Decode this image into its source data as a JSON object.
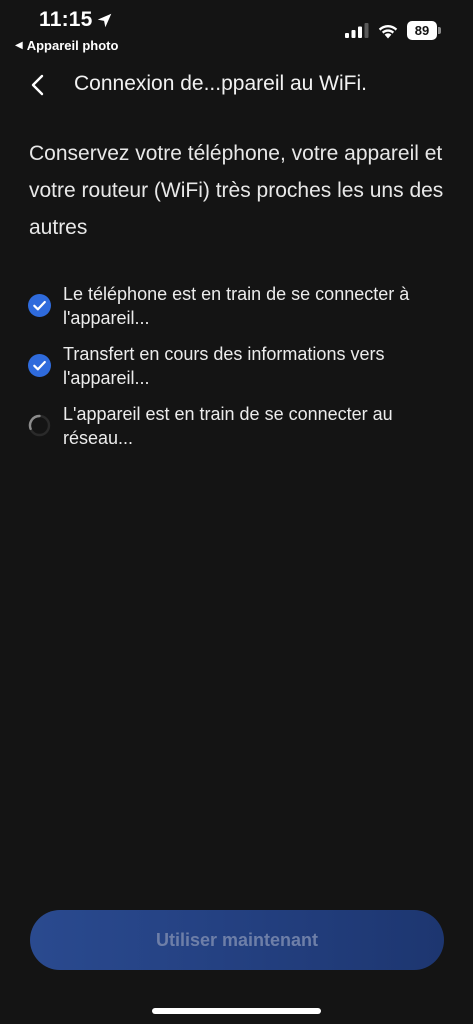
{
  "status_bar": {
    "time": "11:15",
    "back_app": "Appareil photo",
    "battery_level": "89"
  },
  "header": {
    "title": "Connexion de...ppareil au WiFi."
  },
  "main": {
    "instruction": "Conservez votre téléphone, votre appareil et votre routeur (WiFi) très proches les uns des autres",
    "steps": [
      {
        "text": "Le téléphone est en train de se connecter à l'appareil...",
        "status": "done"
      },
      {
        "text": "Transfert en cours des informations vers l'appareil...",
        "status": "done"
      },
      {
        "text": "L'appareil est en train de se connecter au réseau...",
        "status": "in-progress"
      }
    ]
  },
  "footer": {
    "button_label": "Utiliser maintenant"
  },
  "colors": {
    "background": "#141414",
    "accent": "#2f6bdc",
    "button": "#233f7f",
    "button_text": "#6e7fa8"
  },
  "icons": {
    "location": "location-arrow-icon",
    "signal": "cellular-signal-icon",
    "wifi": "wifi-icon",
    "back": "chevron-left-icon",
    "step_done": "check-circle-icon",
    "step_pending": "spinner-icon"
  }
}
